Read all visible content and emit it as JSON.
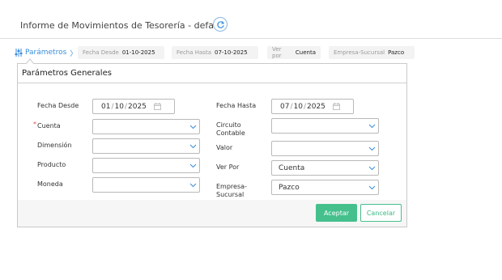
{
  "page": {
    "title": "Informe de Movimientos de Tesorería - default"
  },
  "param_bar": {
    "toggle_label": "Parámetros",
    "chips": [
      {
        "key": "Fecha Desde",
        "value": "01-10-2025"
      },
      {
        "key": "Fecha Hasta",
        "value": "07-10-2025"
      },
      {
        "key": "Ver por",
        "value": "Cuenta"
      },
      {
        "key": "Empresa-Sucursal",
        "value": "Pazco"
      }
    ]
  },
  "panel": {
    "title": "Parámetros Generales",
    "left": {
      "fecha_desde": {
        "label": "Fecha Desde",
        "day": "01",
        "month": "10",
        "year": "2025"
      },
      "cuenta": {
        "label": "Cuenta",
        "required_mark": "*",
        "value": ""
      },
      "dimension": {
        "label": "Dimensión",
        "value": ""
      },
      "producto": {
        "label": "Producto",
        "value": ""
      },
      "moneda": {
        "label": "Moneda",
        "value": ""
      }
    },
    "right": {
      "fecha_hasta": {
        "label": "Fecha Hasta",
        "day": "07",
        "month": "10",
        "year": "2025"
      },
      "circuito": {
        "label_line1": "Circuito",
        "label_line2": "Contable",
        "value": ""
      },
      "valor": {
        "label": "Valor",
        "value": ""
      },
      "ver_por": {
        "label": "Ver Por",
        "value": "Cuenta"
      },
      "empresa": {
        "label_line1": "Empresa-",
        "label_line2": "Sucursal",
        "value": "Pazco"
      }
    },
    "buttons": {
      "accept": "Aceptar",
      "cancel": "Cancelar"
    }
  },
  "colors": {
    "accent": "#3a8dde",
    "primary_button": "#45c08d",
    "required": "#d9534f"
  }
}
